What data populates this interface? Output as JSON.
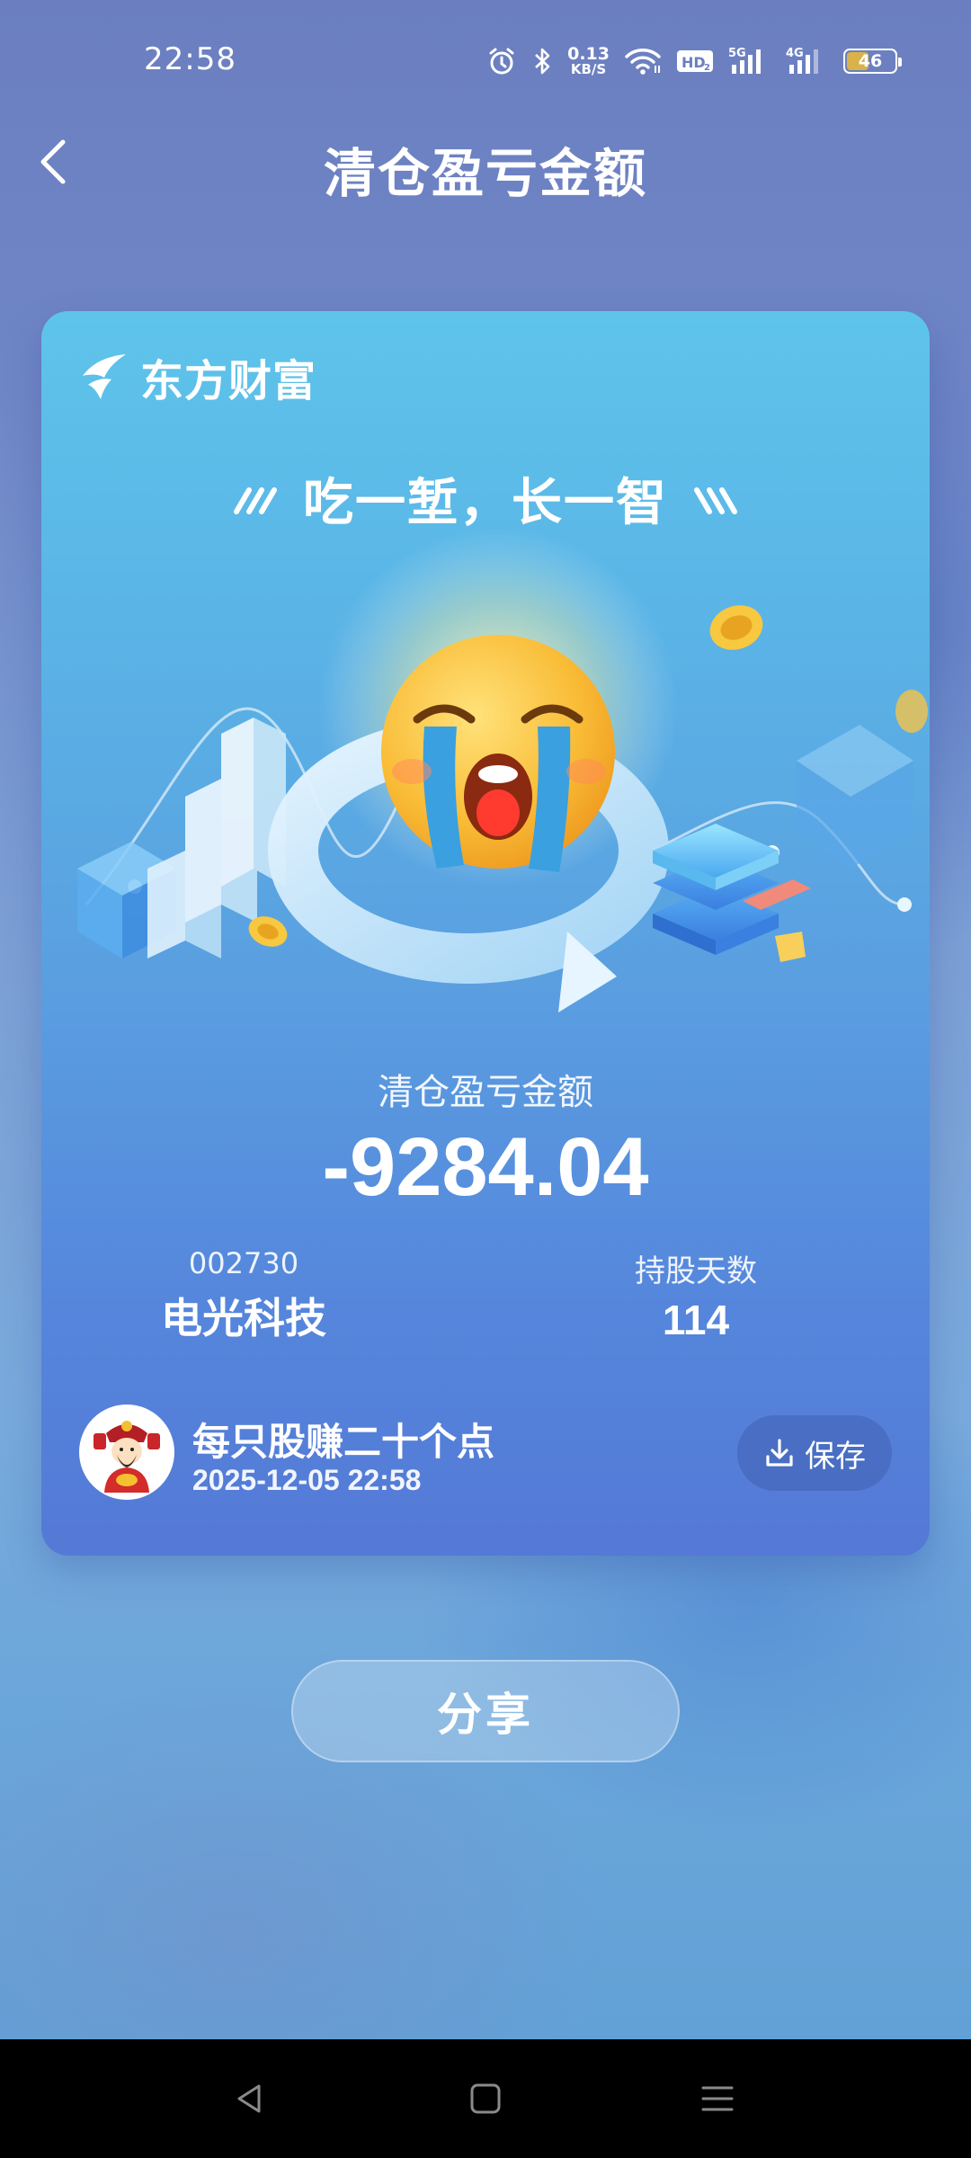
{
  "status_bar": {
    "time": "22:58",
    "net_speed_value": "0.13",
    "net_speed_unit": "KB/S",
    "hd_label": "HD2",
    "signal1_label": "5G",
    "signal2_label": "4G",
    "battery_level": "46",
    "icons": [
      "alarm-icon",
      "bluetooth-icon",
      "wifi-icon",
      "hd-voice-icon",
      "signal-5g-icon",
      "signal-4g-icon",
      "battery-icon"
    ]
  },
  "header": {
    "title": "清仓盈亏金额",
    "back_icon": "chevron-left-icon"
  },
  "card": {
    "brand_name": "东方财富",
    "slogan": "吃一堑，长一智",
    "illustration": "crying-emoji-with-arrow-and-blocks",
    "pl_label": "清仓盈亏金额",
    "pl_amount": "-9284.04",
    "stock_code": "002730",
    "stock_name": "电光科技",
    "days_label": "持股天数",
    "days_value": "114",
    "username": "每只股赚二十个点",
    "timestamp": "2025-12-05 22:58",
    "save_label": "保存",
    "save_icon": "download-icon"
  },
  "share_label": "分享",
  "nav_bar": {
    "back_icon": "nav-back-icon",
    "home_icon": "nav-home-icon",
    "menu_icon": "nav-menu-icon"
  },
  "colors": {
    "card_top": "#5ec4ea",
    "card_bottom": "#5479d6",
    "emoji_yellow": "#f7b733",
    "tear_blue": "#3aa0e0"
  }
}
